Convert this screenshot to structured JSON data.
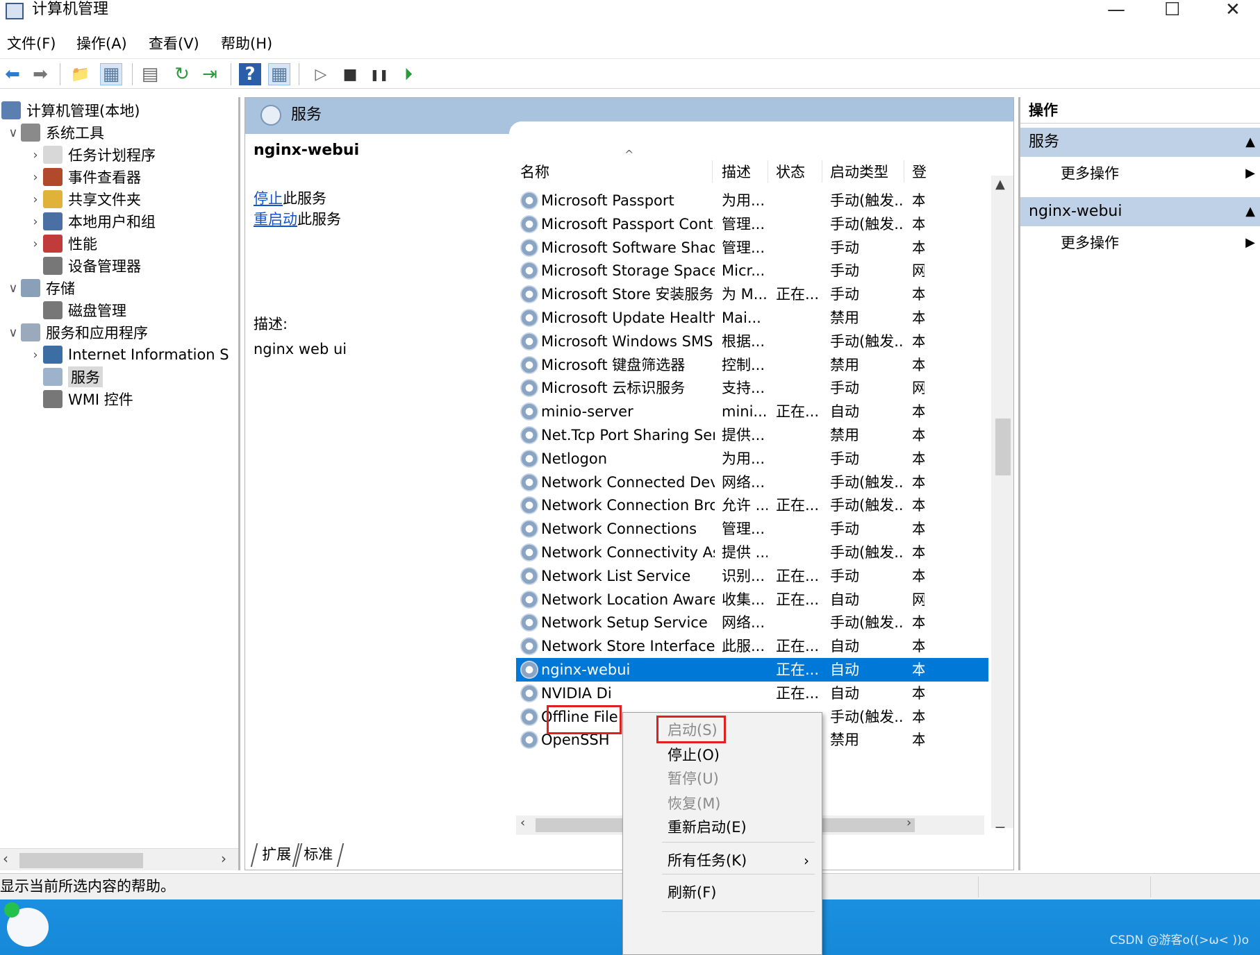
{
  "window": {
    "title": "计算机管理",
    "minimize": "—",
    "maximize": "☐",
    "close": "✕"
  },
  "menu": [
    "文件(F)",
    "操作(A)",
    "查看(V)",
    "帮助(H)"
  ],
  "toolbar": [
    {
      "icon": "back-arrow-icon",
      "glyph": "⬅"
    },
    {
      "icon": "forward-arrow-icon",
      "glyph": "➡"
    },
    {
      "icon": "up-folder-icon",
      "glyph": "📁"
    },
    {
      "icon": "show-hide-tree-icon",
      "glyph": "▦"
    },
    {
      "icon": "properties-icon",
      "glyph": "▤"
    },
    {
      "icon": "refresh-icon",
      "glyph": "↻"
    },
    {
      "icon": "export-list-icon",
      "glyph": "⇥"
    },
    {
      "icon": "help-icon",
      "glyph": "?"
    },
    {
      "icon": "show-action-pane-icon",
      "glyph": "▦"
    },
    {
      "icon": "start-service-icon",
      "glyph": "▷"
    },
    {
      "icon": "stop-service-icon",
      "glyph": "■"
    },
    {
      "icon": "pause-service-icon",
      "glyph": "❚❚"
    },
    {
      "icon": "resume-service-icon",
      "glyph": "⏵"
    }
  ],
  "tree": [
    {
      "label": "计算机管理(本地)",
      "chev": "",
      "level": 0,
      "color": "#5b7fb0"
    },
    {
      "label": "系统工具",
      "chev": "∨",
      "level": 1,
      "color": "#8a8a8a"
    },
    {
      "label": "任务计划程序",
      "chev": "›",
      "level": 2,
      "color": "#d8d8d8"
    },
    {
      "label": "事件查看器",
      "chev": "›",
      "level": 2,
      "color": "#b04a2a"
    },
    {
      "label": "共享文件夹",
      "chev": "›",
      "level": 2,
      "color": "#e0b23a"
    },
    {
      "label": "本地用户和组",
      "chev": "›",
      "level": 2,
      "color": "#4a6fa5"
    },
    {
      "label": "性能",
      "chev": "›",
      "level": 2,
      "color": "#c23b3b"
    },
    {
      "label": "设备管理器",
      "chev": "",
      "level": 2,
      "color": "#777777"
    },
    {
      "label": "存储",
      "chev": "∨",
      "level": 1,
      "color": "#8aa0b8"
    },
    {
      "label": "磁盘管理",
      "chev": "",
      "level": 2,
      "color": "#777777"
    },
    {
      "label": "服务和应用程序",
      "chev": "∨",
      "level": 1,
      "color": "#9aa9bb"
    },
    {
      "label": "Internet Information S",
      "chev": "›",
      "level": 2,
      "color": "#3b6ea5"
    },
    {
      "label": "服务",
      "chev": "",
      "level": 2,
      "color": "#9db3cc",
      "selected": true
    },
    {
      "label": "WMI 控件",
      "chev": "",
      "level": 2,
      "color": "#777777"
    }
  ],
  "mid": {
    "header": "服务",
    "service_name": "nginx-webui",
    "stop_link": "停止",
    "stop_suffix": "此服务",
    "restart_link": "重启动",
    "restart_suffix": "此服务",
    "desc_label": "描述:",
    "desc_text": "nginx web ui"
  },
  "columns": [
    "名称",
    "描述",
    "状态",
    "启动类型",
    "登"
  ],
  "rows": [
    {
      "name": "Microsoft Passport",
      "desc": "为用...",
      "status": "",
      "startup": "手动(触发...",
      "logon": "本"
    },
    {
      "name": "Microsoft Passport Cont...",
      "desc": "管理...",
      "status": "",
      "startup": "手动(触发...",
      "logon": "本"
    },
    {
      "name": "Microsoft Software Shad...",
      "desc": "管理...",
      "status": "",
      "startup": "手动",
      "logon": "本"
    },
    {
      "name": "Microsoft Storage Space...",
      "desc": "Micr...",
      "status": "",
      "startup": "手动",
      "logon": "网"
    },
    {
      "name": "Microsoft Store 安装服务",
      "desc": "为 M...",
      "status": "正在...",
      "startup": "手动",
      "logon": "本"
    },
    {
      "name": "Microsoft Update Health...",
      "desc": "Mai...",
      "status": "",
      "startup": "禁用",
      "logon": "本"
    },
    {
      "name": "Microsoft Windows SMS ...",
      "desc": "根据...",
      "status": "",
      "startup": "手动(触发...",
      "logon": "本"
    },
    {
      "name": "Microsoft 键盘筛选器",
      "desc": "控制...",
      "status": "",
      "startup": "禁用",
      "logon": "本"
    },
    {
      "name": "Microsoft 云标识服务",
      "desc": "支持...",
      "status": "",
      "startup": "手动",
      "logon": "网"
    },
    {
      "name": "minio-server",
      "desc": "mini...",
      "status": "正在...",
      "startup": "自动",
      "logon": "本"
    },
    {
      "name": "Net.Tcp Port Sharing Ser...",
      "desc": "提供...",
      "status": "",
      "startup": "禁用",
      "logon": "本"
    },
    {
      "name": "Netlogon",
      "desc": "为用...",
      "status": "",
      "startup": "手动",
      "logon": "本"
    },
    {
      "name": "Network Connected Devi...",
      "desc": "网络...",
      "status": "",
      "startup": "手动(触发...",
      "logon": "本"
    },
    {
      "name": "Network Connection Bro...",
      "desc": "允许 ...",
      "status": "正在...",
      "startup": "手动(触发...",
      "logon": "本"
    },
    {
      "name": "Network Connections",
      "desc": "管理...",
      "status": "",
      "startup": "手动",
      "logon": "本"
    },
    {
      "name": "Network Connectivity Ass...",
      "desc": "提供 ...",
      "status": "",
      "startup": "手动(触发...",
      "logon": "本"
    },
    {
      "name": "Network List Service",
      "desc": "识别...",
      "status": "正在...",
      "startup": "手动",
      "logon": "本"
    },
    {
      "name": "Network Location Aware...",
      "desc": "收集...",
      "status": "正在...",
      "startup": "自动",
      "logon": "网"
    },
    {
      "name": "Network Setup Service",
      "desc": "网络...",
      "status": "",
      "startup": "手动(触发...",
      "logon": "本"
    },
    {
      "name": "Network Store Interface ...",
      "desc": "此服...",
      "status": "正在...",
      "startup": "自动",
      "logon": "本"
    },
    {
      "name": "nginx-webui",
      "desc": "",
      "status": "正在...",
      "startup": "自动",
      "logon": "本",
      "selected": true
    },
    {
      "name": "NVIDIA Di",
      "desc": "",
      "status": "正在...",
      "startup": "自动",
      "logon": "本"
    },
    {
      "name": "Offline File",
      "desc": "",
      "status": "",
      "startup": "手动(触发...",
      "logon": "本"
    },
    {
      "name": "OpenSSH",
      "desc": "",
      "status": "",
      "startup": "禁用",
      "logon": "本"
    }
  ],
  "tabs": [
    "扩展",
    "标准"
  ],
  "actions": {
    "title": "操作",
    "section1": "服务",
    "more1": "更多操作",
    "section2": "nginx-webui",
    "more2": "更多操作"
  },
  "status_text": "显示当前所选内容的帮助。",
  "context_menu": [
    {
      "label": "启动(S)",
      "disabled": true
    },
    {
      "label": "停止(O)",
      "disabled": false
    },
    {
      "label": "暂停(U)",
      "disabled": true
    },
    {
      "label": "恢复(M)",
      "disabled": true
    },
    {
      "label": "重新启动(E)",
      "disabled": false
    },
    {
      "label": "所有任务(K)",
      "disabled": false,
      "submenu": true
    },
    {
      "label": "刷新(F)",
      "disabled": false
    }
  ],
  "watermark": "CSDN @游客o((>ω< ))o"
}
